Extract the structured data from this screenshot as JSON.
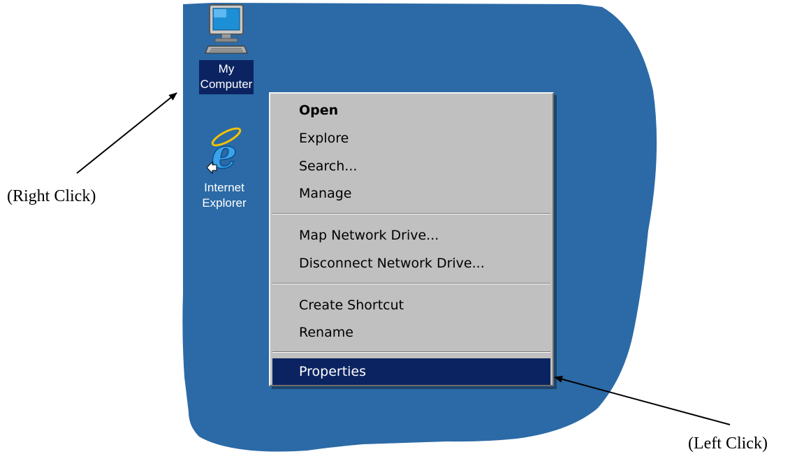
{
  "desktop": {
    "icons": [
      {
        "label_line1": "My",
        "label_line2": "Computer",
        "icon": "computer-icon",
        "selected": true
      },
      {
        "label_line1": "Internet",
        "label_line2": "Explorer",
        "icon": "internet-explorer-icon",
        "selected": false
      }
    ]
  },
  "context_menu": {
    "items": [
      {
        "label": "Open"
      },
      {
        "label": "Explore"
      },
      {
        "label": "Search..."
      },
      {
        "label": "Manage"
      },
      {
        "label": "Map Network Drive..."
      },
      {
        "label": "Disconnect Network Drive..."
      },
      {
        "label": "Create Shortcut"
      },
      {
        "label": "Rename"
      },
      {
        "label": "Properties"
      }
    ]
  },
  "annotations": {
    "right_click": "(Right Click)",
    "left_click": "(Left Click)"
  },
  "colors": {
    "desktop_background": "#2b6aa6",
    "selection_highlight": "#0b2461",
    "menu_background": "#c0c0c0",
    "page_background": "#ffffff"
  }
}
